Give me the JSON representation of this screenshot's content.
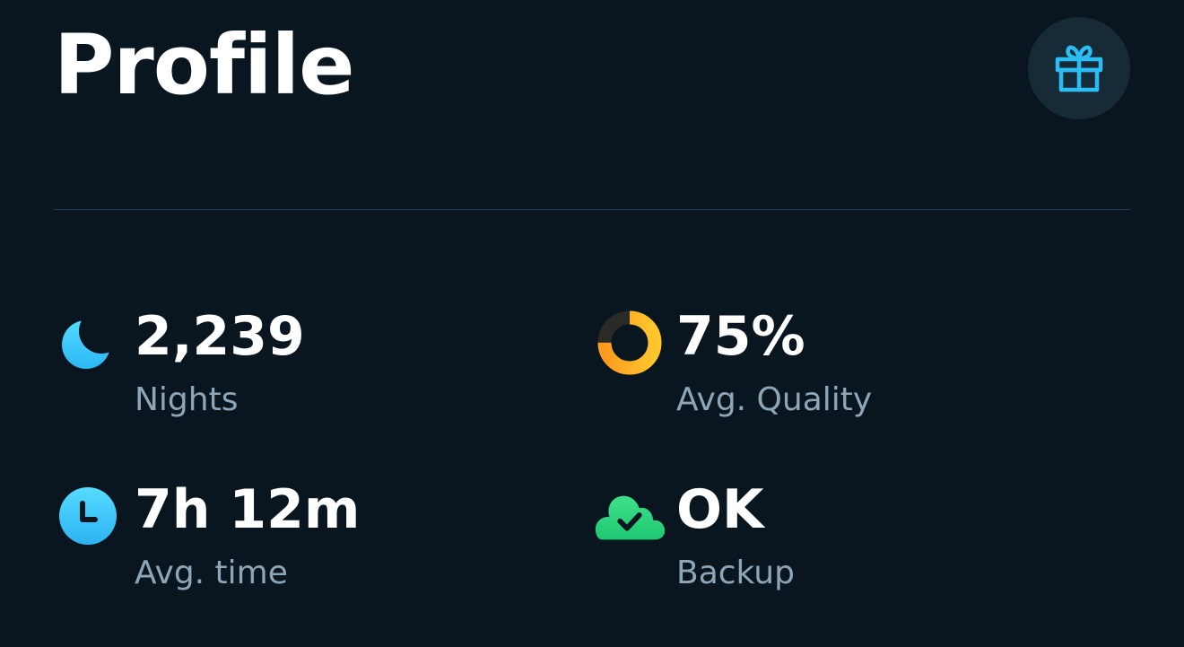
{
  "header": {
    "title": "Profile",
    "gift_icon": "gift-icon"
  },
  "colors": {
    "background": "#091620",
    "accent_blue": "#2dbdf5",
    "accent_orange": "#f5a623",
    "accent_green": "#2ed47a",
    "label_grey": "#8fa6b8"
  },
  "stats": {
    "nights": {
      "value": "2,239",
      "label": "Nights",
      "icon": "moon-icon"
    },
    "quality": {
      "value": "75%",
      "label": "Avg. Quality",
      "icon": "quality-ring-icon",
      "fraction": 0.75
    },
    "time": {
      "value": "7h 12m",
      "label": "Avg. time",
      "icon": "clock-icon"
    },
    "backup": {
      "value": "OK",
      "label": "Backup",
      "icon": "cloud-check-icon"
    }
  }
}
